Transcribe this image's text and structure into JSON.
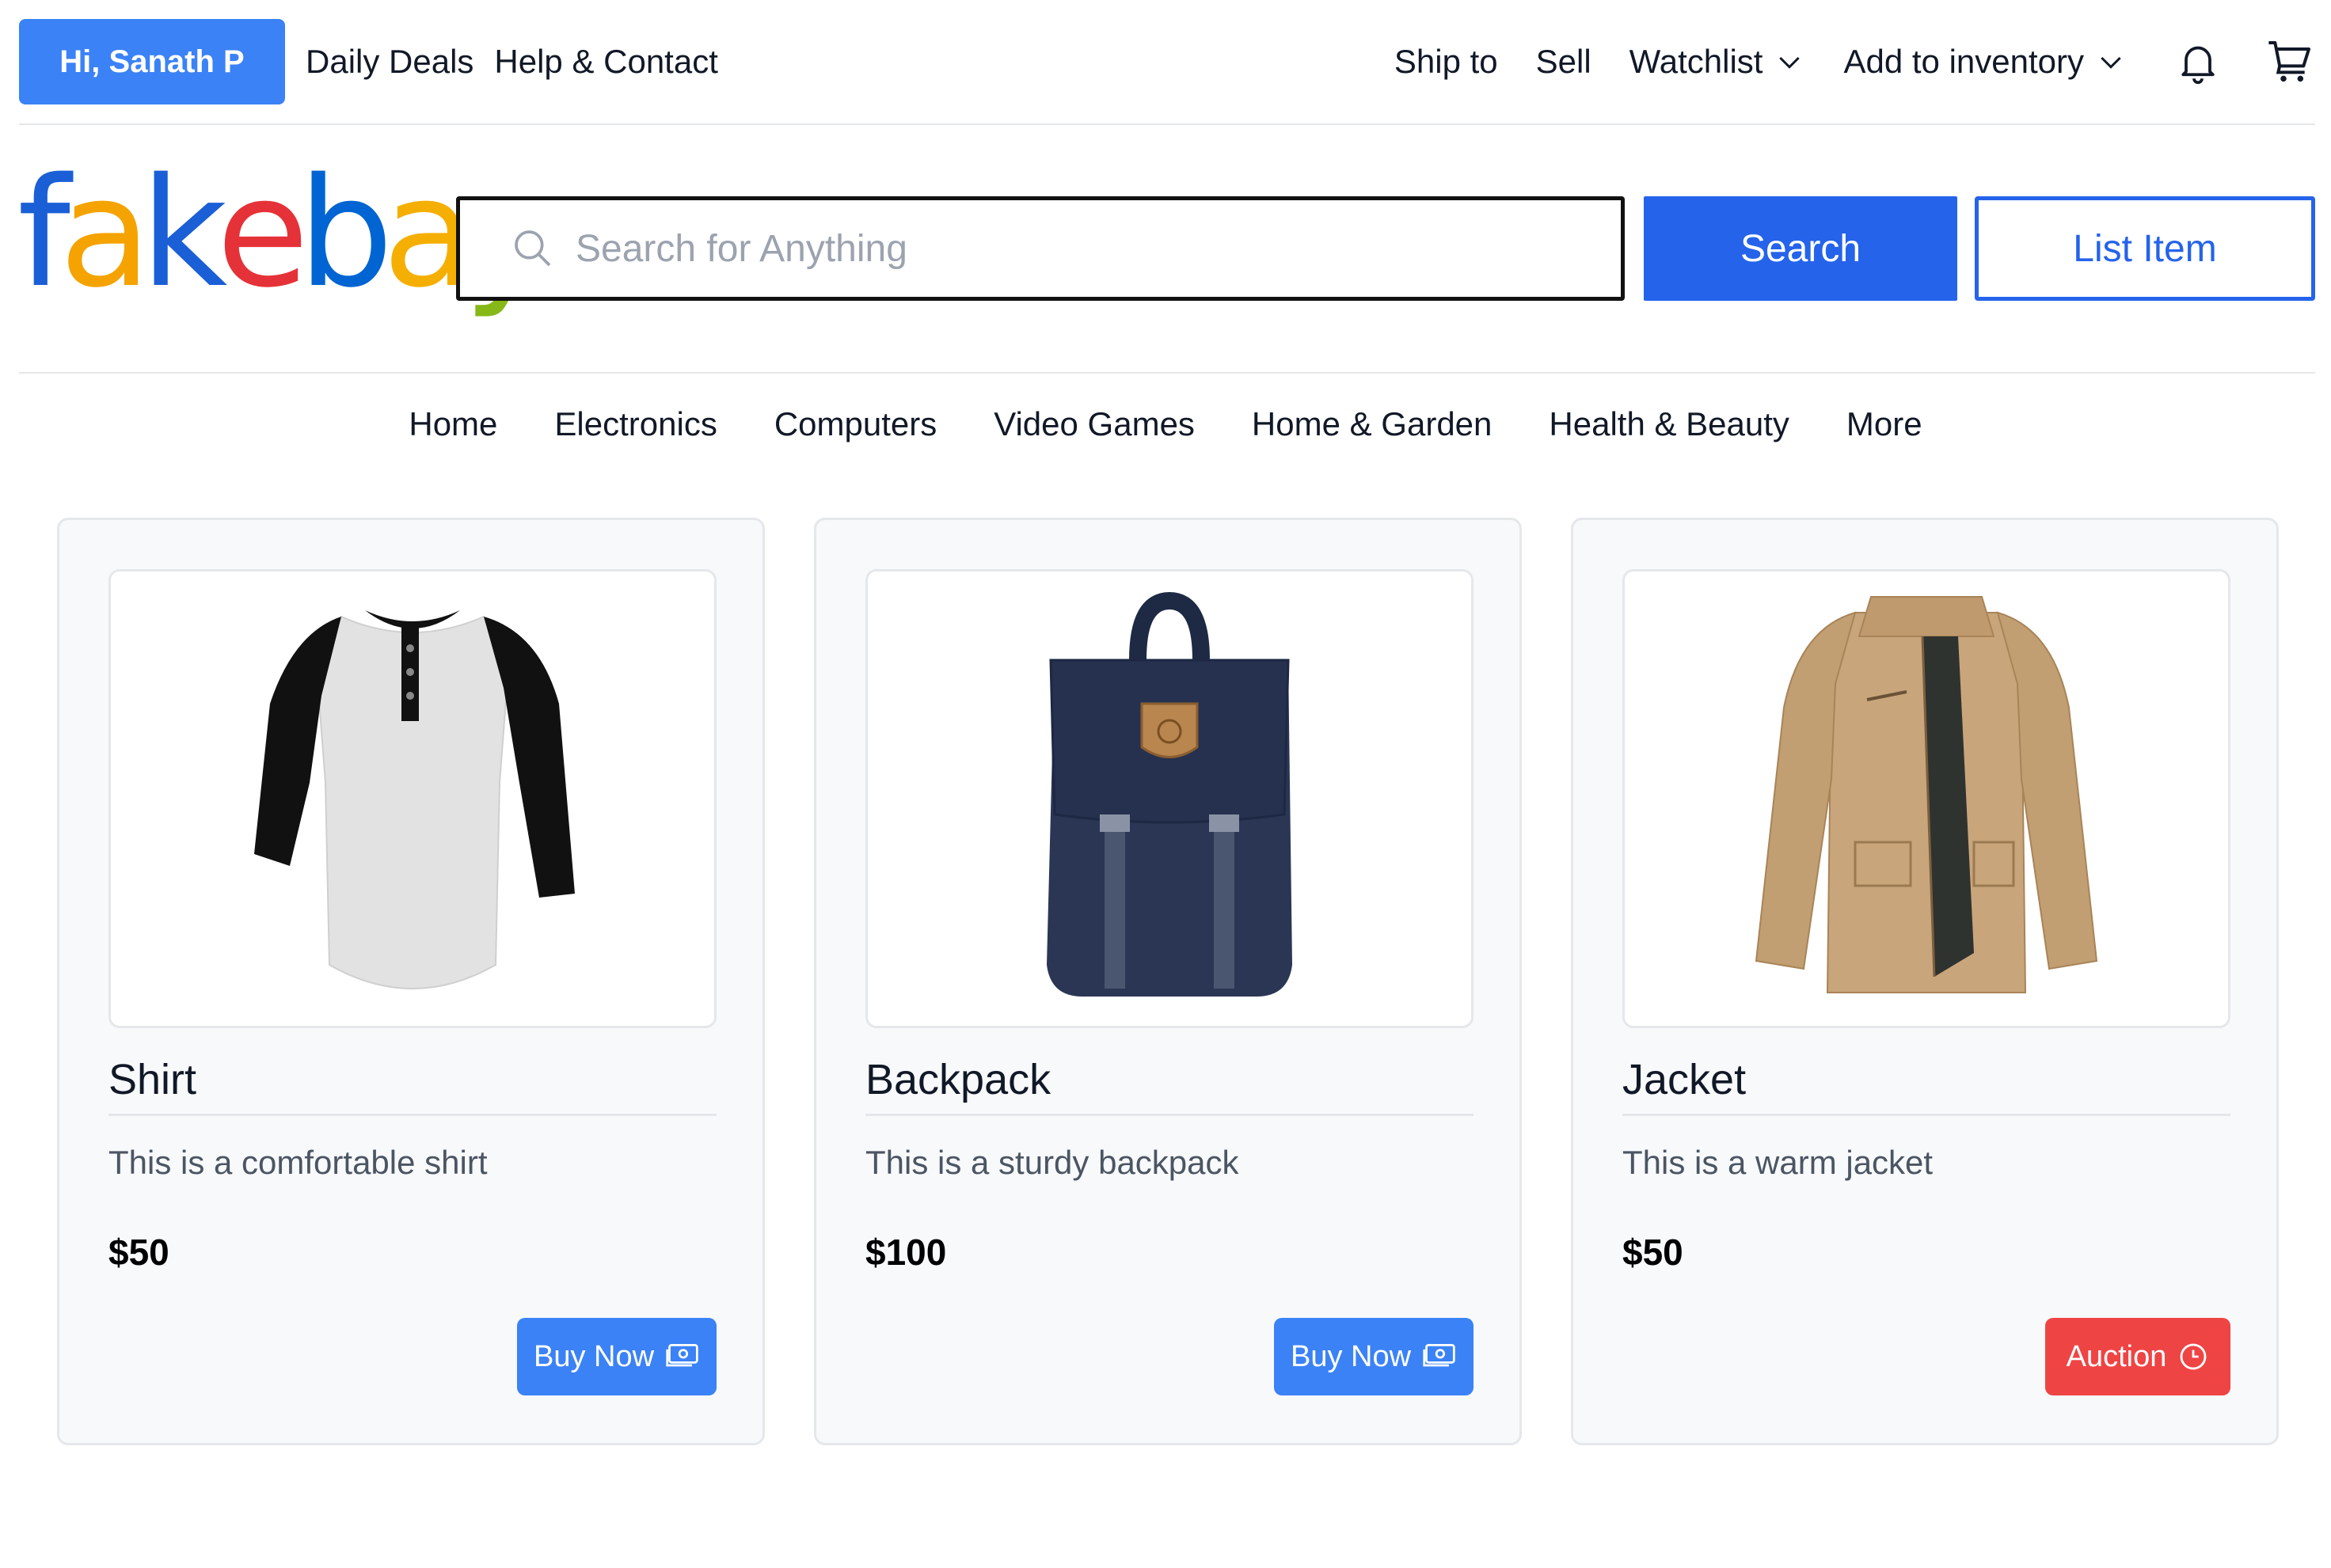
{
  "top_bar": {
    "greeting": "Hi, Sanath P",
    "left_links": [
      "Daily Deals",
      "Help & Contact"
    ],
    "ship_to": "Ship to",
    "sell": "Sell",
    "watchlist": "Watchlist",
    "add_to_inventory": "Add to inventory",
    "icons": [
      "bell-icon",
      "cart-icon"
    ]
  },
  "header": {
    "logo_letters": [
      {
        "char": "f",
        "color": "#1a5fd6"
      },
      {
        "char": "a",
        "color": "#f5a300"
      },
      {
        "char": "k",
        "color": "#1a5fd6"
      },
      {
        "char": "e",
        "color": "#e53238"
      },
      {
        "char": "b",
        "color": "#0064d2"
      },
      {
        "char": "a",
        "color": "#f5af02"
      },
      {
        "char": "y",
        "color": "#86b817"
      }
    ],
    "search_placeholder": "Search for Anything",
    "search_button": "Search",
    "list_item_button": "List Item"
  },
  "categories": [
    "Home",
    "Electronics",
    "Computers",
    "Video Games",
    "Home & Garden",
    "Health & Beauty",
    "More"
  ],
  "products": [
    {
      "title": "Shirt",
      "description": "This is a comfortable shirt",
      "price": "$50",
      "action": "Buy Now",
      "action_icon": "cash-icon",
      "image": "shirt-image"
    },
    {
      "title": "Backpack",
      "description": "This is a sturdy backpack",
      "price": "$100",
      "action": "Buy Now",
      "action_icon": "cash-icon",
      "image": "backpack-image"
    },
    {
      "title": "Jacket",
      "description": "This is a warm jacket",
      "price": "$50",
      "action": "Auction",
      "action_icon": "clock-icon",
      "image": "jacket-image"
    }
  ],
  "colors": {
    "primary": "#3b82f6",
    "search_blue": "#2563eb",
    "auction_red": "#ef4444"
  }
}
